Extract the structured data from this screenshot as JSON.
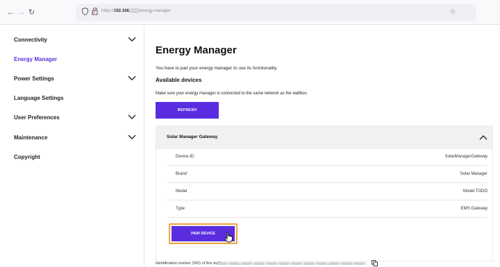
{
  "browser": {
    "back_icon": "←",
    "forward_icon": "→",
    "reload_icon": "↻",
    "url_prefix": "https://",
    "url_host": "192.168.",
    "url_mask": "▒▒▒",
    "url_path": "/energy-manager",
    "bookmark_icon": "☆"
  },
  "sidebar": {
    "items": [
      {
        "label": "Connectivity",
        "has_chevron": true,
        "active": false
      },
      {
        "label": "Energy Manager",
        "has_chevron": false,
        "active": true
      },
      {
        "label": "Power Settings",
        "has_chevron": true,
        "active": false
      },
      {
        "label": "Language Settings",
        "has_chevron": false,
        "active": false
      },
      {
        "label": "User Preferences",
        "has_chevron": true,
        "active": false
      },
      {
        "label": "Maintenance",
        "has_chevron": true,
        "active": false
      },
      {
        "label": "Copyright",
        "has_chevron": false,
        "active": false
      }
    ]
  },
  "main": {
    "title": "Energy Manager",
    "info": "You have to pair your energy manager to use its functionality.",
    "section_title": "Available devices",
    "hint": "Make sure your energy manager is connected to the same network as the wallbox.",
    "refresh_label": "REFRESH",
    "device": {
      "name": "Solar Manager Gateway",
      "expanded": true,
      "rows": [
        {
          "key": "Device-ID",
          "value": "SolarManagerGateway"
        },
        {
          "key": "Brand",
          "value": "Solar Manager"
        },
        {
          "key": "Model",
          "value": "Model TODO"
        },
        {
          "key": "Type",
          "value": "EMS Gateway"
        }
      ],
      "pair_label": "PAIR DEVICE"
    },
    "identification_label": "Identification number (SKI) of this wallbox:"
  },
  "colors": {
    "accent": "#5b2de0",
    "active_nav": "#5a2fd6",
    "highlight": "#f2a243"
  },
  "icons": {
    "chevron_down": "chevron-down-icon",
    "chevron_up": "chevron-up-icon",
    "copy": "copy-icon",
    "cursor": "hand-cursor-icon"
  }
}
